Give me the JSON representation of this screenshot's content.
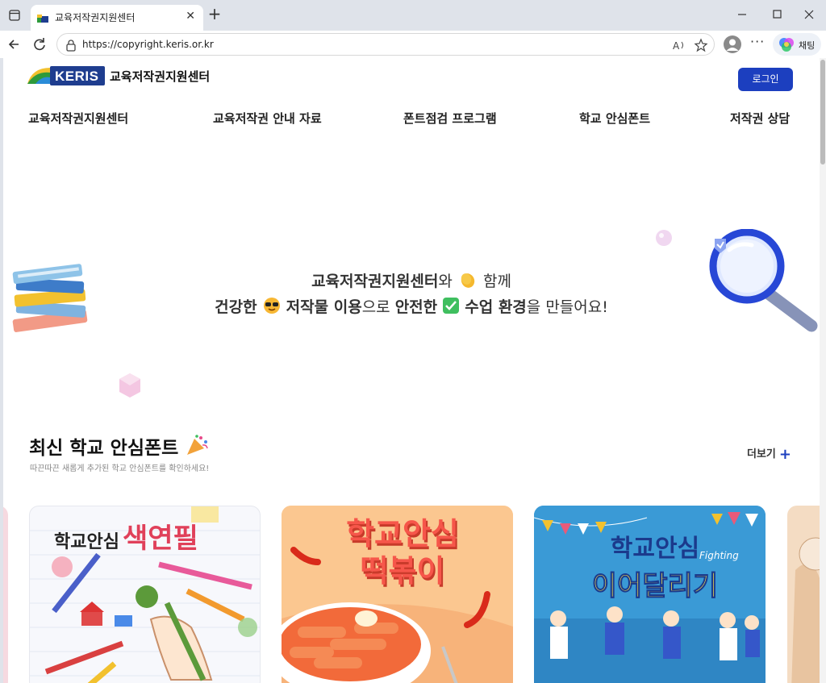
{
  "browser": {
    "tab_title": "교육저작권지원센터",
    "url": "https://copyright.keris.or.kr",
    "copilot_label": "채팅"
  },
  "header": {
    "logo_text": "KERIS",
    "site_name": "교육저작권지원센터",
    "login_label": "로그인"
  },
  "nav": [
    {
      "label": "교육저작권지원센터"
    },
    {
      "label": "교육저작권 안내 자료"
    },
    {
      "label": "폰트점검 프로그램"
    },
    {
      "label": "학교 안심폰트"
    },
    {
      "label": "저작권 상담"
    }
  ],
  "hero": {
    "line1_bold": "교육저작권지원센터",
    "line1_rest": "와",
    "line1_end": "함께",
    "line2_a": "건강한",
    "line2_b": "저작물 이용",
    "line2_c": "으로",
    "line2_d": "안전한",
    "line2_e": "수업 환경",
    "line2_f": "을 만들어요!"
  },
  "section": {
    "title": "최신 학교 안심폰트",
    "subtitle": "따끈따끈 새롭게 추가된 학교 안심폰트를 확인하세요!",
    "more_label": "더보기"
  },
  "cards": [
    {
      "prefix": "학교안심",
      "name": "색연필"
    },
    {
      "prefix": "학교안심",
      "name": "떡볶이"
    },
    {
      "prefix": "학교안심",
      "name": "이어달리기",
      "tag": "Fighting"
    }
  ],
  "colors": {
    "brand": "#1e3d8f",
    "accent": "#1c3fbf"
  }
}
